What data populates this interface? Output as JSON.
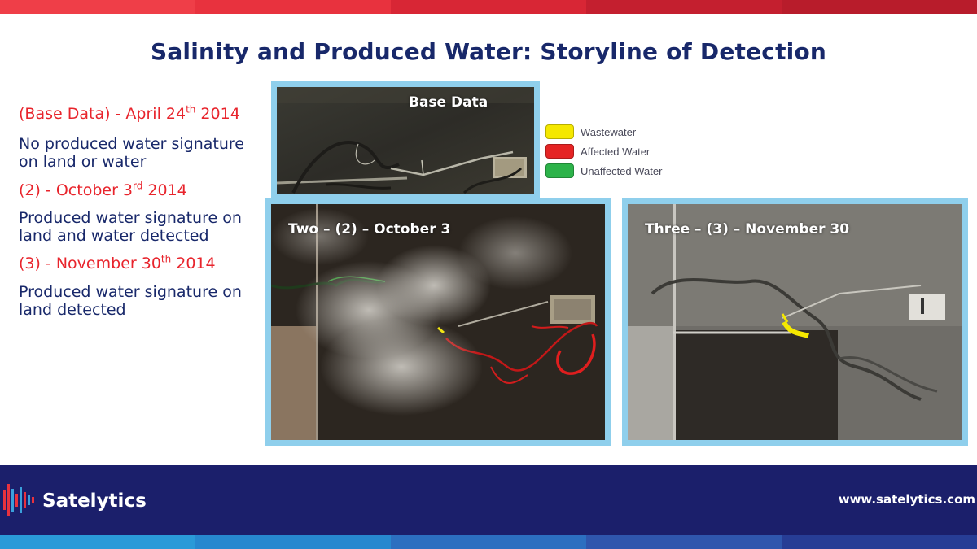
{
  "title": "Salinity and Produced Water: Storyline of Detection",
  "timeline": [
    {
      "date_pre": "(Base Data) - April 24",
      "date_sup": "th",
      "date_post": " 2014",
      "desc_line1": "No produced water signature",
      "desc_line2": "on land or water"
    },
    {
      "date_pre": "(2) - October 3",
      "date_sup": "rd",
      "date_post": " 2014",
      "desc_line1": "Produced water signature on",
      "desc_line2": "land and water detected"
    },
    {
      "date_pre": "(3) - November 30",
      "date_sup": "th",
      "date_post": " 2014",
      "desc_line1": "Produced water signature on",
      "desc_line2": "land detected"
    }
  ],
  "panels": {
    "base": {
      "label": "Base Data"
    },
    "two": {
      "label": "Two – (2) – October 3"
    },
    "three": {
      "label": "Three – (3) – November 30"
    }
  },
  "legend": [
    {
      "label": "Wastewater",
      "color": "#f5e800"
    },
    {
      "label": "Affected Water",
      "color": "#e52424"
    },
    {
      "label": "Unaffected Water",
      "color": "#2db34a"
    }
  ],
  "footer": {
    "brand": "Satelytics",
    "url": "www.satelytics.com"
  }
}
